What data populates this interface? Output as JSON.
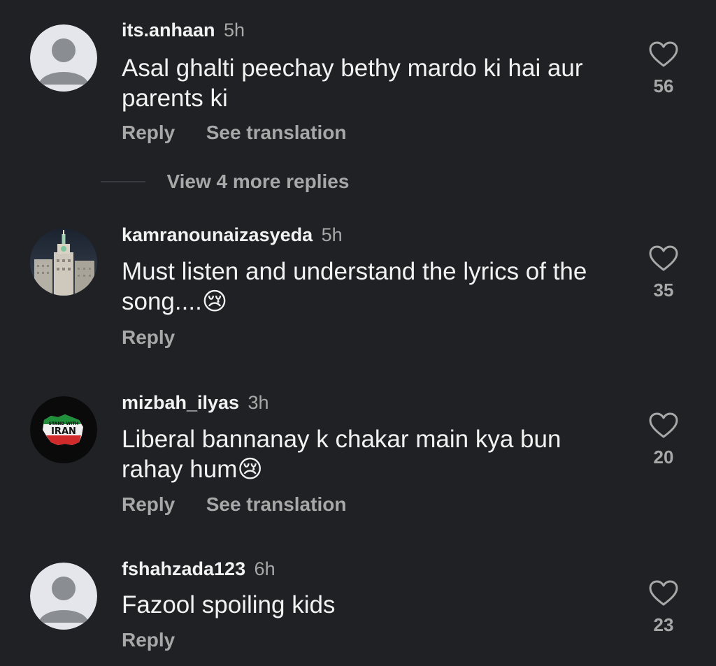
{
  "comments": [
    {
      "username": "its.anhaan",
      "time": "5h",
      "text": "Asal ghalti peechay bethy mardo ki hai aur parents ki",
      "reply_label": "Reply",
      "translate_label": "See translation",
      "likes": "56",
      "avatar": "default-avatar-icon"
    },
    {
      "username": "kamranounaizasyeda",
      "time": "5h",
      "text": "Must listen and understand the lyrics of the song....😢",
      "reply_label": "Reply",
      "likes": "35",
      "avatar": "clock-tower-photo"
    },
    {
      "username": "mizbah_ilyas",
      "time": "3h",
      "text": "Liberal bannanay k chakar main kya bun rahay hum😢",
      "reply_label": "Reply",
      "translate_label": "See translation",
      "likes": "20",
      "avatar": "stand-with-iran-map",
      "avatar_text_1": "STAND WITH",
      "avatar_text_2": "IRAN"
    },
    {
      "username": "fshahzada123",
      "time": "6h",
      "text": "Fazool spoiling kids",
      "reply_label": "Reply",
      "likes": "23",
      "avatar": "default-avatar-icon"
    }
  ],
  "view_replies_label": "View 4 more replies",
  "colors": {
    "background": "#202125",
    "primary_text": "#f2f2f2",
    "secondary_text": "#a8a8a8"
  }
}
